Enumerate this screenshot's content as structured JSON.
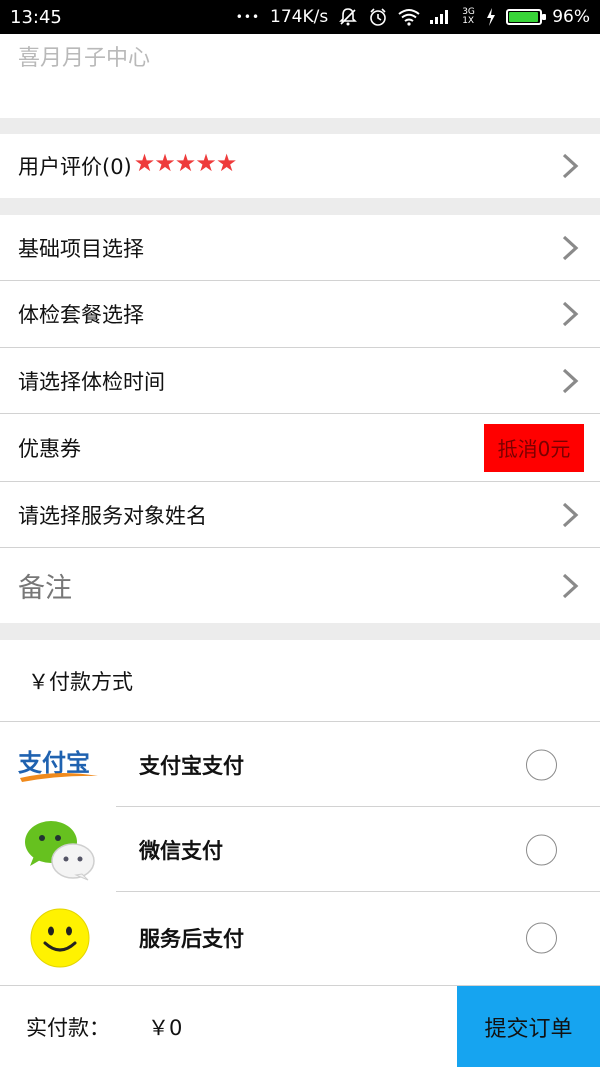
{
  "status_bar": {
    "time": "13:45",
    "more": "•••",
    "speed": "174K/s",
    "network": "3G 1X",
    "battery": "96%",
    "battery_level": 0.96,
    "battery_color": "#39d439"
  },
  "center": {
    "name": "喜月月子中心"
  },
  "review": {
    "label": "用户评价(0)",
    "stars": "★★★★★",
    "star_color": "#ee3b3b"
  },
  "rows": {
    "basic_project": "基础项目选择",
    "checkup_package": "体检套餐选择",
    "checkup_time": "请选择体检时间",
    "coupon": "优惠券",
    "service_name": "请选择服务对象姓名",
    "remark": "备注"
  },
  "coupon_button": {
    "label": "抵消0元",
    "color": "#ff0000"
  },
  "payment": {
    "title": "￥付款方式",
    "methods": [
      {
        "name": "支付宝支付",
        "icon": "alipay-logo"
      },
      {
        "name": "微信支付",
        "icon": "wechat-logo"
      },
      {
        "name": "服务后支付",
        "icon": "smiley-logo"
      }
    ]
  },
  "footer": {
    "paid_label": "实付款：",
    "paid_amount": "￥0",
    "submit_label": "提交订单",
    "submit_color": "#16a4f0"
  }
}
